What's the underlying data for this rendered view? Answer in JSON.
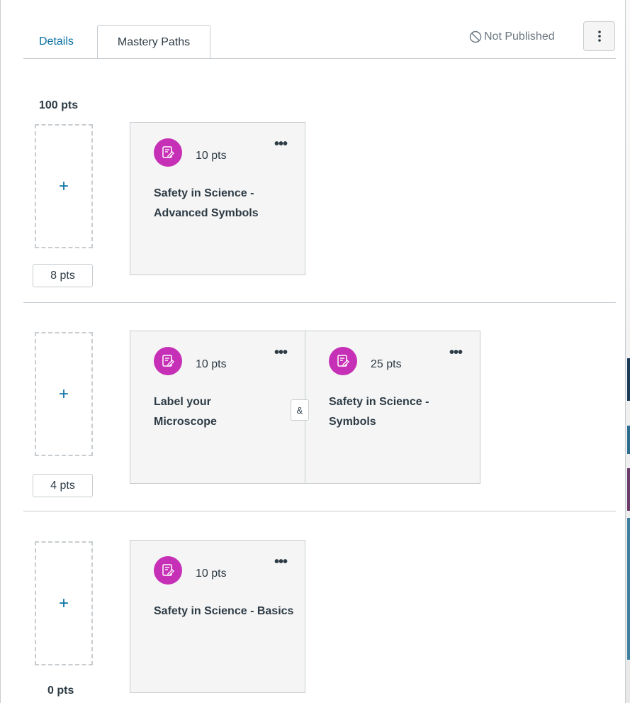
{
  "tabs": {
    "details": "Details",
    "mastery_paths": "Mastery Paths"
  },
  "status": {
    "label": "Not Published",
    "icon": "not-published-icon"
  },
  "ranges": [
    {
      "upper_label": "100 pts",
      "lower_score": "8 pts",
      "assignments": [
        {
          "points": "10 pts",
          "title": "Safety in Science - Advanced Symbols",
          "icon": "assignment-icon"
        }
      ]
    },
    {
      "lower_score": "4 pts",
      "and_label": "&",
      "assignments": [
        {
          "points": "10 pts",
          "title": "Label your Microscope",
          "icon": "assignment-icon"
        },
        {
          "points": "25 pts",
          "title": "Safety in Science - Symbols",
          "icon": "assignment-icon"
        }
      ]
    },
    {
      "lower_label": "0 pts",
      "assignments": [
        {
          "points": "10 pts",
          "title": "Safety in Science - Basics",
          "icon": "assignment-icon"
        }
      ]
    }
  ],
  "colors": {
    "accent": "#0770a3",
    "badge": "#c630b6",
    "border": "#c7cdd1",
    "card_bg": "#f5f5f5",
    "text": "#2d3b45"
  }
}
